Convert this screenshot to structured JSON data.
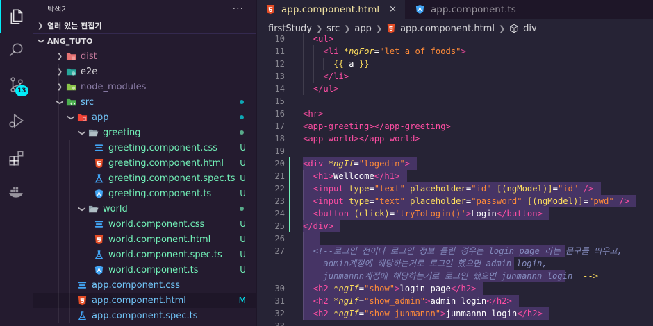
{
  "colors": {
    "accent": "#03edf9",
    "untracked": "#72f1b8",
    "modified": "#03edf9",
    "git_added": "#72f1b8"
  },
  "activity": {
    "icons": [
      "files-icon",
      "search-icon",
      "source-control-icon",
      "run-debug-icon",
      "extensions-icon",
      "docker-icon"
    ],
    "scm_badge": "13"
  },
  "sidebar": {
    "title": "탐색기",
    "more": "···",
    "open_editors": "열려 있는 편집기",
    "project": "ANG_TUTO",
    "items": [
      {
        "name": "dist",
        "depth": 1,
        "kind": "folder",
        "expanded": false,
        "icon": "folder-dist-icon",
        "color": "#c2789a",
        "status": ""
      },
      {
        "name": "e2e",
        "depth": 1,
        "kind": "folder",
        "expanded": false,
        "icon": "folder-e2e-icon",
        "color": "#ffffffcc",
        "status": ""
      },
      {
        "name": "node_modules",
        "depth": 1,
        "kind": "folder",
        "expanded": false,
        "icon": "folder-node-icon",
        "color": "#8c7ea8",
        "status": ""
      },
      {
        "name": "src",
        "depth": 1,
        "kind": "folder",
        "expanded": true,
        "icon": "folder-src-icon",
        "color": "#72c6f9",
        "status": "dot-blue"
      },
      {
        "name": "app",
        "depth": 2,
        "kind": "folder",
        "expanded": true,
        "icon": "folder-app-icon",
        "color": "#72c6f9",
        "status": "dot-blue"
      },
      {
        "name": "greeting",
        "depth": 3,
        "kind": "folder",
        "expanded": true,
        "icon": "folder-open-icon",
        "color": "#72f1b8",
        "status": "dot-green"
      },
      {
        "name": "greeting.component.css",
        "depth": 4,
        "kind": "file",
        "icon": "css-file-icon",
        "color": "#72f1b8",
        "status": "U"
      },
      {
        "name": "greeting.component.html",
        "depth": 4,
        "kind": "file",
        "icon": "html-file-icon",
        "color": "#72f1b8",
        "status": "U"
      },
      {
        "name": "greeting.component.spec.ts",
        "depth": 4,
        "kind": "file",
        "icon": "test-file-icon",
        "color": "#72f1b8",
        "status": "U"
      },
      {
        "name": "greeting.component.ts",
        "depth": 4,
        "kind": "file",
        "icon": "angular-file-icon",
        "color": "#72f1b8",
        "status": "U"
      },
      {
        "name": "world",
        "depth": 3,
        "kind": "folder",
        "expanded": true,
        "icon": "folder-open-icon",
        "color": "#72f1b8",
        "status": "dot-green"
      },
      {
        "name": "world.component.css",
        "depth": 4,
        "kind": "file",
        "icon": "css-file-icon",
        "color": "#72f1b8",
        "status": "U"
      },
      {
        "name": "world.component.html",
        "depth": 4,
        "kind": "file",
        "icon": "html-file-icon",
        "color": "#72f1b8",
        "status": "U"
      },
      {
        "name": "world.component.spec.ts",
        "depth": 4,
        "kind": "file",
        "icon": "test-file-icon",
        "color": "#72f1b8",
        "status": "U"
      },
      {
        "name": "world.component.ts",
        "depth": 4,
        "kind": "file",
        "icon": "angular-file-icon",
        "color": "#72f1b8",
        "status": "U"
      },
      {
        "name": "app.component.css",
        "depth": 3,
        "kind": "file",
        "icon": "css-file-icon",
        "color": "#72c6f9",
        "status": ""
      },
      {
        "name": "app.component.html",
        "depth": 3,
        "kind": "file",
        "icon": "html-file-icon",
        "color": "#72c6f9",
        "status": "M",
        "selected": true
      },
      {
        "name": "app.component.spec.ts",
        "depth": 3,
        "kind": "file",
        "icon": "test-file-icon",
        "color": "#72c6f9",
        "status": ""
      }
    ]
  },
  "tabs": [
    {
      "label": "app.component.html",
      "icon": "html-file-icon",
      "active": true,
      "close": "×"
    },
    {
      "label": "app.component.ts",
      "icon": "angular-file-icon",
      "active": false,
      "close": ""
    }
  ],
  "breadcrumb": [
    "firstStudy",
    "src",
    "app",
    "app.component.html",
    "div"
  ],
  "code": [
    {
      "n": "10",
      "git": "",
      "indent": 1,
      "sel": false,
      "tokens": [
        [
          "t-tag",
          "<ul>"
        ]
      ]
    },
    {
      "n": "11",
      "git": "",
      "indent": 2,
      "sel": false,
      "tokens": [
        [
          "t-tag",
          "<li "
        ],
        [
          "t-dir",
          "*ngFor"
        ],
        [
          "t-txt",
          "="
        ],
        [
          "t-str",
          "\"let a of foods\""
        ],
        [
          "t-tag",
          ">"
        ]
      ]
    },
    {
      "n": "12",
      "git": "",
      "indent": 3,
      "sel": false,
      "tokens": [
        [
          "t-attr",
          "{{ "
        ],
        [
          "t-txt",
          "a"
        ],
        [
          "t-attr",
          " }}"
        ]
      ]
    },
    {
      "n": "13",
      "git": "",
      "indent": 2,
      "sel": false,
      "tokens": [
        [
          "t-tag",
          "</li>"
        ]
      ]
    },
    {
      "n": "14",
      "git": "",
      "indent": 1,
      "sel": false,
      "tokens": [
        [
          "t-tag",
          "</ul>"
        ]
      ]
    },
    {
      "n": "15",
      "git": "",
      "indent": 0,
      "sel": false,
      "tokens": []
    },
    {
      "n": "16",
      "git": "",
      "indent": 0,
      "sel": false,
      "tokens": [
        [
          "t-tag",
          "<hr>"
        ]
      ]
    },
    {
      "n": "17",
      "git": "",
      "indent": 0,
      "sel": false,
      "tokens": [
        [
          "t-tag",
          "<app-greeting></app-greeting>"
        ]
      ]
    },
    {
      "n": "18",
      "git": "",
      "indent": 0,
      "sel": false,
      "tokens": [
        [
          "t-tag",
          "<app-world></app-world>"
        ]
      ]
    },
    {
      "n": "19",
      "git": "",
      "indent": 0,
      "sel": false,
      "tokens": []
    },
    {
      "n": "20",
      "git": "added",
      "indent": 0,
      "sel": true,
      "tokens": [
        [
          "t-tag",
          "<div "
        ],
        [
          "t-dir",
          "*ngIf"
        ],
        [
          "t-txt",
          "="
        ],
        [
          "t-str",
          "\"logedin\""
        ],
        [
          "t-tag",
          ">"
        ]
      ]
    },
    {
      "n": "21",
      "git": "added",
      "indent": 1,
      "sel": true,
      "tokens": [
        [
          "t-tag",
          "<h1>"
        ],
        [
          "t-txt",
          "Wellcome"
        ],
        [
          "t-tag",
          "</h1>"
        ]
      ]
    },
    {
      "n": "22",
      "git": "added",
      "indent": 1,
      "sel": true,
      "tokens": [
        [
          "t-tag",
          "<input "
        ],
        [
          "t-attr",
          "type"
        ],
        [
          "t-txt",
          "="
        ],
        [
          "t-str",
          "\"text\""
        ],
        [
          "t-txt",
          " "
        ],
        [
          "t-attr",
          "placeholder"
        ],
        [
          "t-txt",
          "="
        ],
        [
          "t-str",
          "\"id\""
        ],
        [
          "t-txt",
          " "
        ],
        [
          "t-attr",
          "[(ngModel)]"
        ],
        [
          "t-txt",
          "="
        ],
        [
          "t-str",
          "\"id\""
        ],
        [
          "t-txt",
          " "
        ],
        [
          "t-tag",
          "/>"
        ]
      ]
    },
    {
      "n": "23",
      "git": "added",
      "indent": 1,
      "sel": true,
      "tokens": [
        [
          "t-tag",
          "<input "
        ],
        [
          "t-attr",
          "type"
        ],
        [
          "t-txt",
          "="
        ],
        [
          "t-str",
          "\"text\""
        ],
        [
          "t-txt",
          " "
        ],
        [
          "t-attr",
          "placeholder"
        ],
        [
          "t-txt",
          "="
        ],
        [
          "t-str",
          "\"password\""
        ],
        [
          "t-txt",
          " "
        ],
        [
          "t-attr",
          "[(ngModel)]"
        ],
        [
          "t-txt",
          "="
        ],
        [
          "t-str",
          "\"pwd\""
        ],
        [
          "t-txt",
          " "
        ],
        [
          "t-tag",
          "/>"
        ]
      ]
    },
    {
      "n": "24",
      "git": "added",
      "indent": 1,
      "sel": true,
      "tokens": [
        [
          "t-tag",
          "<button "
        ],
        [
          "t-attr",
          "(click)"
        ],
        [
          "t-txt",
          "="
        ],
        [
          "t-str",
          "'tryToLogin()'"
        ],
        [
          "t-tag",
          ">"
        ],
        [
          "t-txt",
          "Login"
        ],
        [
          "t-tag",
          "</button>"
        ]
      ]
    },
    {
      "n": "25",
      "git": "added",
      "indent": 0,
      "sel": true,
      "tokens": [
        [
          "t-tag",
          "</div>"
        ]
      ]
    },
    {
      "n": "26",
      "git": "",
      "indent": 1,
      "sel": true,
      "tokens": []
    },
    {
      "n": "27",
      "git": "",
      "indent": 1,
      "sel": true,
      "tokens": [
        [
          "t-cmt",
          "<!--로그인 전이나 로그인 정보 틀린 경우는 login page 라는 문구를 띄우고,"
        ]
      ]
    },
    {
      "n": "",
      "git": "",
      "indent": 1,
      "sel": true,
      "tokens": [
        [
          "t-cmt",
          "  admin계정에 해당하는거로 로그인 했으면 admin login,"
        ]
      ]
    },
    {
      "n": "",
      "git": "",
      "indent": 1,
      "sel": true,
      "tokens": [
        [
          "t-cmt",
          "  junmannn계정에 해당하는거로 로그인 했으면 junmannn login  "
        ],
        [
          "t-attr",
          "-->"
        ]
      ]
    },
    {
      "n": "30",
      "git": "",
      "indent": 1,
      "sel": true,
      "tokens": [
        [
          "t-tag",
          "<h2 "
        ],
        [
          "t-dir",
          "*ngIf"
        ],
        [
          "t-txt",
          "="
        ],
        [
          "t-str",
          "\"show\""
        ],
        [
          "t-tag",
          ">"
        ],
        [
          "t-txt",
          "login page"
        ],
        [
          "t-tag",
          "</h2>"
        ]
      ]
    },
    {
      "n": "31",
      "git": "",
      "indent": 1,
      "sel": true,
      "tokens": [
        [
          "t-tag",
          "<h2 "
        ],
        [
          "t-dir",
          "*ngIf"
        ],
        [
          "t-txt",
          "="
        ],
        [
          "t-str",
          "\"show_admin\""
        ],
        [
          "t-tag",
          ">"
        ],
        [
          "t-txt",
          "admin login"
        ],
        [
          "t-tag",
          "</h2>"
        ]
      ]
    },
    {
      "n": "32",
      "git": "",
      "indent": 1,
      "sel": true,
      "tokens": [
        [
          "t-tag",
          "<h2 "
        ],
        [
          "t-dir",
          "*ngIf"
        ],
        [
          "t-txt",
          "="
        ],
        [
          "t-str",
          "\"show_junmannn\""
        ],
        [
          "t-tag",
          ">"
        ],
        [
          "t-txt",
          "junmannn login"
        ],
        [
          "t-tag",
          "</h2>"
        ]
      ]
    },
    {
      "n": "33",
      "git": "",
      "indent": 0,
      "sel": false,
      "tokens": []
    }
  ]
}
